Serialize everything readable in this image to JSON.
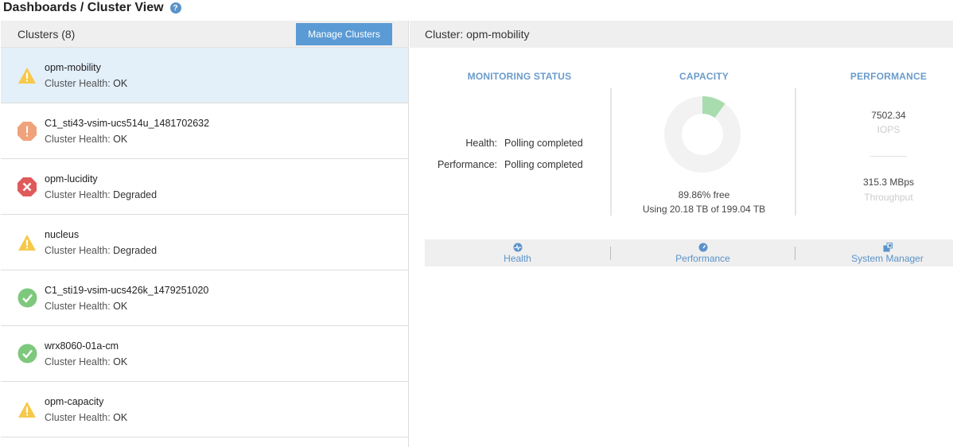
{
  "page": {
    "title": "Dashboards / Cluster View",
    "help_icon": "?"
  },
  "left_panel": {
    "header_title": "Clusters (8)",
    "manage_button": "Manage Clusters",
    "clusters": [
      {
        "name": "opm-mobility",
        "health_label": "Cluster Health:",
        "health": "OK",
        "status_icon": "warning-icon",
        "selected": true
      },
      {
        "name": "C1_sti43-vsim-ucs514u_1481702632",
        "health_label": "Cluster Health:",
        "health": "OK",
        "status_icon": "error-icon",
        "selected": false
      },
      {
        "name": "opm-lucidity",
        "health_label": "Cluster Health:",
        "health": "Degraded",
        "status_icon": "critical-icon",
        "selected": false
      },
      {
        "name": "nucleus",
        "health_label": "Cluster Health:",
        "health": "Degraded",
        "status_icon": "warning-icon",
        "selected": false
      },
      {
        "name": "C1_sti19-vsim-ucs426k_1479251020",
        "health_label": "Cluster Health:",
        "health": "OK",
        "status_icon": "ok-icon",
        "selected": false
      },
      {
        "name": "wrx8060-01a-cm",
        "health_label": "Cluster Health:",
        "health": "OK",
        "status_icon": "ok-icon",
        "selected": false
      },
      {
        "name": "opm-capacity",
        "health_label": "Cluster Health:",
        "health": "OK",
        "status_icon": "warning-icon",
        "selected": false
      }
    ]
  },
  "right_panel": {
    "header_title": "Cluster: opm-mobility",
    "monitoring": {
      "title": "MONITORING STATUS",
      "health_label": "Health:",
      "health_value": "Polling completed",
      "performance_label": "Performance:",
      "performance_value": "Polling completed"
    },
    "capacity": {
      "title": "CAPACITY",
      "free_text": "89.86% free",
      "used_text": "Using 20.18 TB of 199.04 TB",
      "used_fraction": 0.1014
    },
    "performance": {
      "title": "PERFORMANCE",
      "iops_value": "7502.34",
      "iops_label": "IOPS",
      "throughput_value": "315.3 MBps",
      "throughput_label": "Throughput"
    },
    "actions": [
      {
        "label": "Health",
        "icon": "health-pulse-icon"
      },
      {
        "label": "Performance",
        "icon": "gauge-icon"
      },
      {
        "label": "System Manager",
        "icon": "external-link-icon"
      }
    ]
  },
  "colors": {
    "accent": "#5b9bd5",
    "selected_row": "#e3eff9",
    "warning": "#f6c94a",
    "error": "#f0a27a",
    "critical": "#e05a5a",
    "ok": "#7ec87e",
    "donut_used": "#a8dcae",
    "donut_free": "#f2f2f2"
  }
}
